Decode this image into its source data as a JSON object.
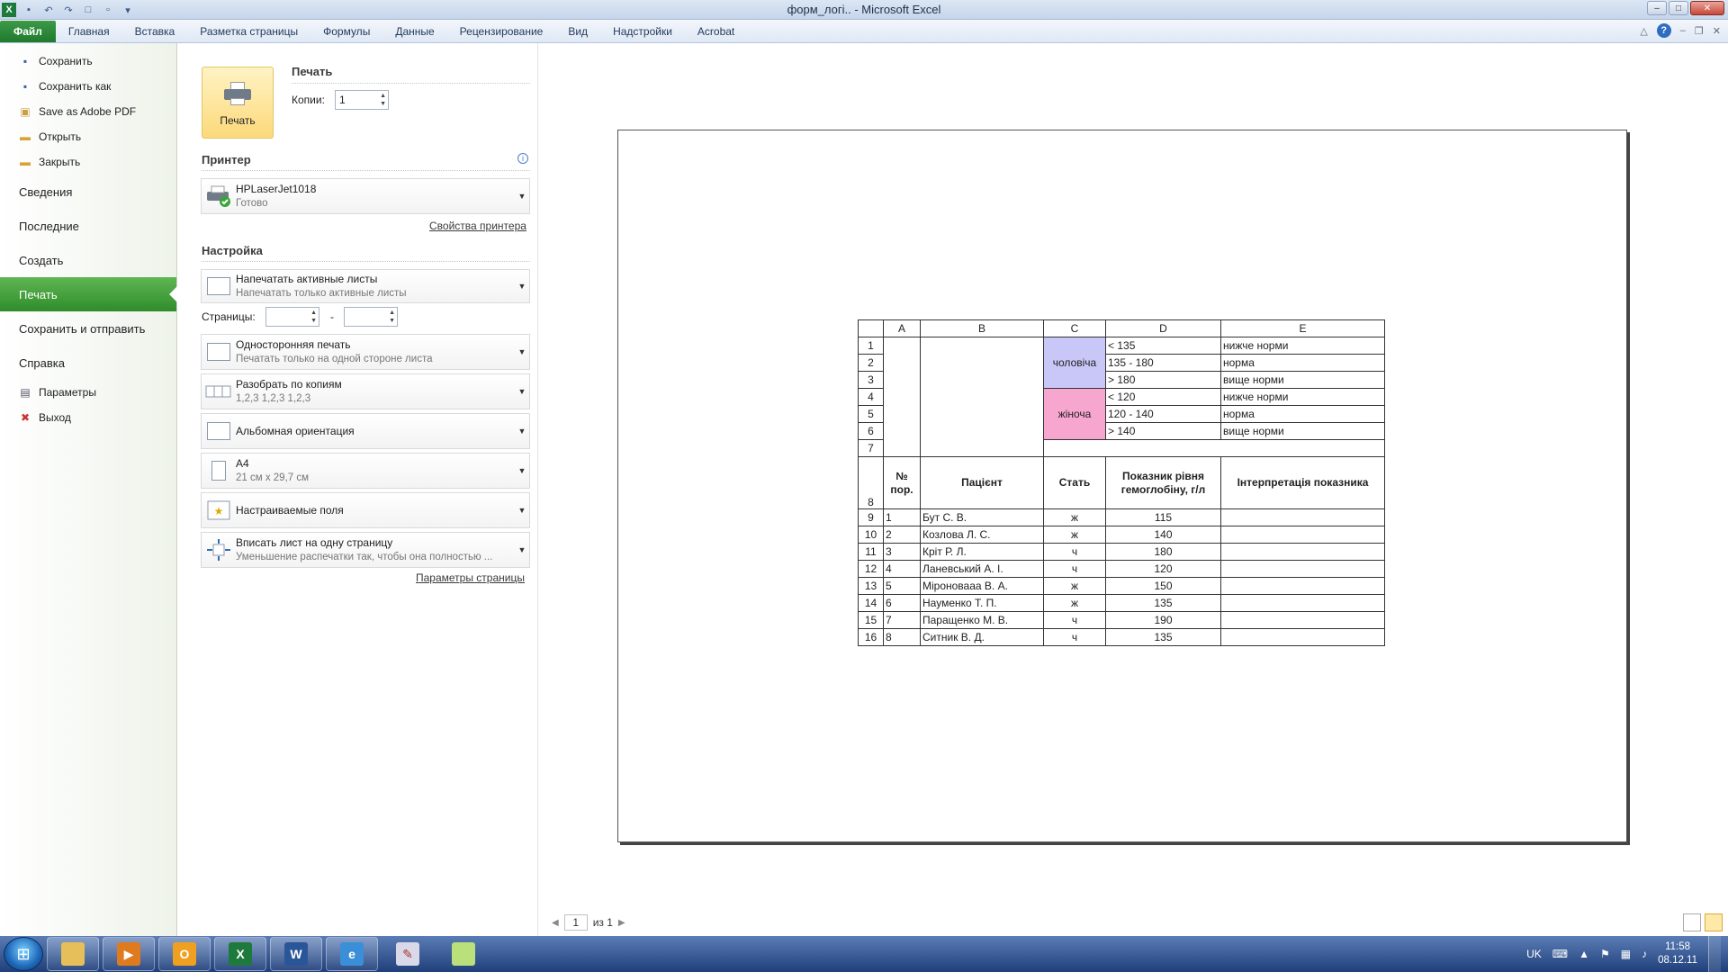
{
  "window": {
    "title": "форм_логі..  -  Microsoft Excel"
  },
  "ribbon": {
    "tabs": [
      "Файл",
      "Главная",
      "Вставка",
      "Разметка страницы",
      "Формулы",
      "Данные",
      "Рецензирование",
      "Вид",
      "Надстройки",
      "Acrobat"
    ]
  },
  "nav": {
    "cmd_save": "Сохранить",
    "cmd_save_as": "Сохранить как",
    "cmd_save_pdf": "Save as Adobe PDF",
    "cmd_open": "Открыть",
    "cmd_close": "Закрыть",
    "info": "Сведения",
    "recent": "Последние",
    "new": "Создать",
    "print": "Печать",
    "save_send": "Сохранить и отправить",
    "help": "Справка",
    "options": "Параметры",
    "exit": "Выход"
  },
  "print": {
    "section_title": "Печать",
    "button_label": "Печать",
    "copies_label": "Копии:",
    "copies_value": "1",
    "printer_section": "Принтер",
    "printer_name": "HPLaserJet1018",
    "printer_status": "Готово",
    "printer_props": "Свойства принтера",
    "settings_section": "Настройка",
    "what": {
      "title": "Напечатать активные листы",
      "sub": "Напечатать только активные листы"
    },
    "pages_label": "Страницы:",
    "pages_dash": "-",
    "sides": {
      "title": "Односторонняя печать",
      "sub": "Печатать только на одной стороне листа"
    },
    "collate": {
      "title": "Разобрать по копиям",
      "sub": "1,2,3    1,2,3    1,2,3"
    },
    "orientation": {
      "title": "Альбомная ориентация"
    },
    "paper": {
      "title": "A4",
      "sub": "21 см x 29,7 см"
    },
    "margins": {
      "title": "Настраиваемые поля"
    },
    "scaling": {
      "title": "Вписать лист на одну страницу",
      "sub": "Уменьшение распечатки так, чтобы она полностью ..."
    },
    "page_setup": "Параметры страницы"
  },
  "preview": {
    "page_current": "1",
    "page_of": "из 1",
    "col_headers": [
      "A",
      "B",
      "C",
      "D",
      "E"
    ],
    "rows_top": [
      {
        "n": "1",
        "d": "< 135",
        "e": "нижче норми"
      },
      {
        "n": "2",
        "d": "135 - 180",
        "e": "норма"
      },
      {
        "n": "3",
        "d": "> 180",
        "e": "вище норми"
      },
      {
        "n": "4",
        "d": "< 120",
        "e": "нижче норми"
      },
      {
        "n": "5",
        "d": "120 - 140",
        "e": "норма"
      },
      {
        "n": "6",
        "d": "> 140",
        "e": "вище норми"
      }
    ],
    "male": "чоловіча",
    "female": "жіноча",
    "row7": "7",
    "row8": "8",
    "headers": {
      "no": "№ пор.",
      "patient": "Пацієнт",
      "sex": "Стать",
      "hb": "Показник рівня гемоглобіну, г/л",
      "interp": "Інтерпретація показника"
    },
    "patients": [
      {
        "row": "9",
        "no": "1",
        "name": "Бут С. В.",
        "sex": "ж",
        "hb": "115"
      },
      {
        "row": "10",
        "no": "2",
        "name": "Козлова Л. С.",
        "sex": "ж",
        "hb": "140"
      },
      {
        "row": "11",
        "no": "3",
        "name": "Кріт Р. Л.",
        "sex": "ч",
        "hb": "180"
      },
      {
        "row": "12",
        "no": "4",
        "name": "Ланевський А. І.",
        "sex": "ч",
        "hb": "120"
      },
      {
        "row": "13",
        "no": "5",
        "name": "Міроновааа В. А.",
        "sex": "ж",
        "hb": "150"
      },
      {
        "row": "14",
        "no": "6",
        "name": "Науменко Т. П.",
        "sex": "ж",
        "hb": "135"
      },
      {
        "row": "15",
        "no": "7",
        "name": "Паращенко М. В.",
        "sex": "ч",
        "hb": "190"
      },
      {
        "row": "16",
        "no": "8",
        "name": "Ситник В. Д.",
        "sex": "ч",
        "hb": "135"
      }
    ]
  },
  "taskbar": {
    "lang": "UK",
    "time": "11:58",
    "date": "08.12.11"
  },
  "colors": {
    "file_tab": "#2f8c2a",
    "male_fill": "#c9c7f7",
    "female_fill": "#f7a6cf"
  }
}
